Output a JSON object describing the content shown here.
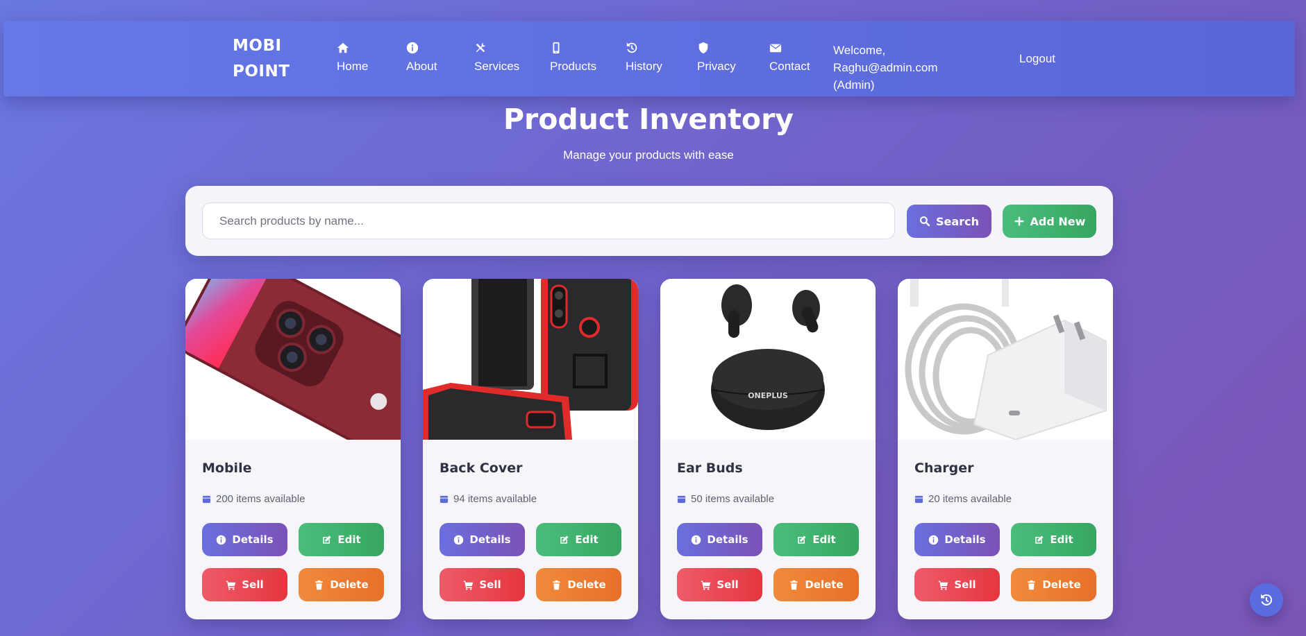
{
  "brand": {
    "line1": "MOBI",
    "line2": "POINT"
  },
  "nav": [
    {
      "label": "Home",
      "icon": "home-icon"
    },
    {
      "label": "About",
      "icon": "info-icon"
    },
    {
      "label": "Services",
      "icon": "tools-icon"
    },
    {
      "label": "Products",
      "icon": "phone-icon"
    },
    {
      "label": "History",
      "icon": "history-icon"
    },
    {
      "label": "Privacy",
      "icon": "shield-icon"
    },
    {
      "label": "Contact",
      "icon": "envelope-icon"
    }
  ],
  "user": {
    "welcome_line1": "Welcome, Raghu@admin.com",
    "welcome_line2": "(Admin)",
    "logout_label": "Logout"
  },
  "page": {
    "title": "Product Inventory",
    "subtitle": "Manage your products with ease"
  },
  "search": {
    "placeholder": "Search products by name...",
    "search_label": "Search",
    "add_label": "Add New"
  },
  "products": [
    {
      "name": "Mobile",
      "stock": "200 items available"
    },
    {
      "name": "Back Cover",
      "stock": "94 items available"
    },
    {
      "name": "Ear Buds",
      "stock": "50 items available"
    },
    {
      "name": "Charger",
      "stock": "20 items available"
    }
  ],
  "card_actions": {
    "details": "Details",
    "edit": "Edit",
    "sell": "Sell",
    "delete": "Delete"
  },
  "earbuds_case_logo": "ONEPLUS",
  "colors": {
    "primary": "#6a6fde",
    "success": "#3fb06c",
    "danger": "#e5363f",
    "warning": "#e8702a"
  }
}
